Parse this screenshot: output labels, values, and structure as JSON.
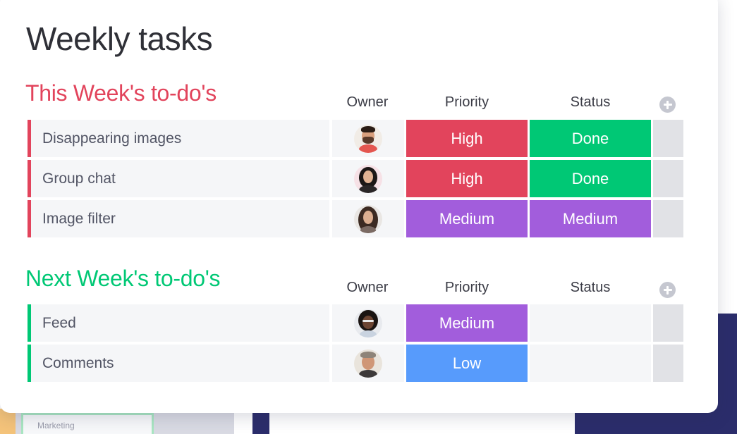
{
  "page": {
    "title": "Weekly tasks"
  },
  "columns": {
    "owner": "Owner",
    "priority": "Priority",
    "status": "Status"
  },
  "colors": {
    "this_week": "#e2445c",
    "next_week": "#00c875",
    "high": "#e2445c",
    "done": "#00c875",
    "medium": "#a25ddc",
    "low": "#579bfc"
  },
  "groups": [
    {
      "title": "This Week's to-do's",
      "title_color": "#e2445c",
      "rows": [
        {
          "name": "Disappearing images",
          "owner_icon": "avatar-man-beard",
          "priority": "High",
          "priority_color": "#e2445c",
          "status": "Done",
          "status_color": "#00c875"
        },
        {
          "name": "Group chat",
          "owner_icon": "avatar-woman-dark-hair",
          "priority": "High",
          "priority_color": "#e2445c",
          "status": "Done",
          "status_color": "#00c875"
        },
        {
          "name": "Image filter",
          "owner_icon": "avatar-woman-long-hair",
          "priority": "Medium",
          "priority_color": "#a25ddc",
          "status": "Medium",
          "status_color": "#a25ddc"
        }
      ]
    },
    {
      "title": "Next Week's to-do's",
      "title_color": "#00c875",
      "rows": [
        {
          "name": "Feed",
          "owner_icon": "avatar-woman-glasses",
          "priority": "Medium",
          "priority_color": "#a25ddc",
          "status": "",
          "status_color": ""
        },
        {
          "name": "Comments",
          "owner_icon": "avatar-man-grey-hair",
          "priority": "Low",
          "priority_color": "#579bfc",
          "status": "",
          "status_color": ""
        }
      ]
    }
  ],
  "background": {
    "mini_card_label": "Marketing"
  }
}
